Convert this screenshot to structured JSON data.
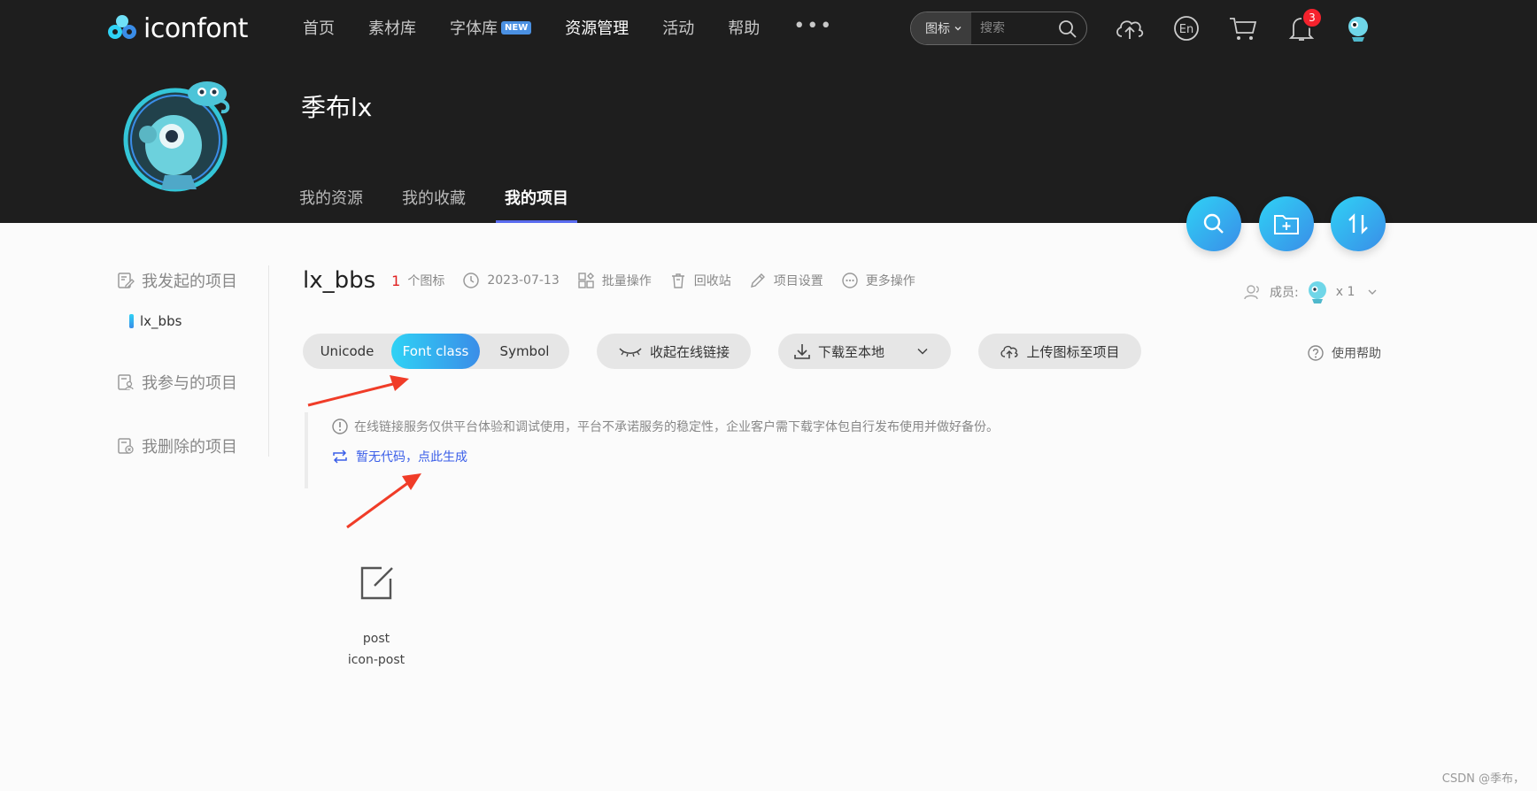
{
  "header": {
    "logo_text": "iconfont",
    "nav": [
      {
        "label": "首页"
      },
      {
        "label": "素材库"
      },
      {
        "label": "字体库",
        "badge": "NEW"
      },
      {
        "label": "资源管理",
        "active": true
      },
      {
        "label": "活动"
      },
      {
        "label": "帮助"
      }
    ],
    "more": "•••",
    "search": {
      "type": "图标",
      "placeholder": "搜索"
    },
    "notifications_count": "3"
  },
  "profile": {
    "name": "季布lx",
    "tabs": [
      {
        "label": "我的资源"
      },
      {
        "label": "我的收藏"
      },
      {
        "label": "我的项目",
        "active": true
      }
    ]
  },
  "sidebar": {
    "items": [
      {
        "label": "我发起的项目",
        "icon": "edit-doc-icon"
      },
      {
        "label": "我参与的项目",
        "icon": "person-doc-icon"
      },
      {
        "label": "我删除的项目",
        "icon": "trash-doc-icon"
      }
    ],
    "sub_item": "lx_bbs"
  },
  "project": {
    "title": "lx_bbs",
    "icon_count": "1",
    "icon_count_unit": "个图标",
    "date": "2023-07-13",
    "actions": [
      "批量操作",
      "回收站",
      "项目设置",
      "更多操作"
    ],
    "members_label": "成员:",
    "members_count": "x 1"
  },
  "toolbar": {
    "tabs": [
      "Unicode",
      "Font class",
      "Symbol"
    ],
    "active_tab": "Font class",
    "collapse_link": "收起在线链接",
    "download": "下载至本地",
    "upload": "上传图标至项目",
    "help": "使用帮助"
  },
  "notice": {
    "text": "在线链接服务仅供平台体验和调试使用，平台不承诺服务的稳定性，企业客户需下载字体包自行发布使用并做好备份。",
    "generate_link": "暂无代码，点此生成"
  },
  "icons": [
    {
      "name": "post",
      "class": "icon-post"
    }
  ],
  "watermark": "CSDN @季布，",
  "colors": {
    "accent_start": "#2fd2f5",
    "accent_end": "#3a8de8",
    "link": "#3a5ee8",
    "arrow": "#f03c28",
    "header_bg": "#1e1e1e"
  }
}
